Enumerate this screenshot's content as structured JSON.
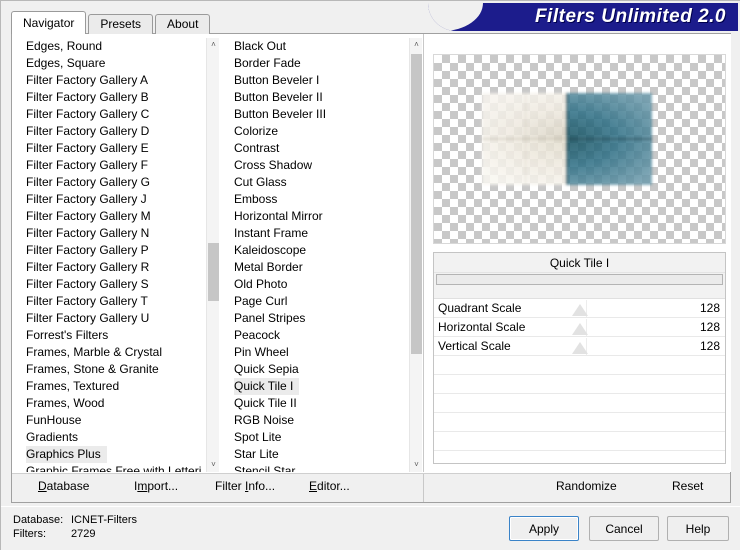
{
  "window": {
    "banner_title": "Filters Unlimited 2.0",
    "brand_color": "#1c1c8c"
  },
  "tabs": [
    {
      "label": "Navigator",
      "active": true
    },
    {
      "label": "Presets",
      "active": false
    },
    {
      "label": "About",
      "active": false
    }
  ],
  "categories": {
    "scroll_thumb_pct": 55,
    "selected": "Graphics Plus",
    "items": [
      "Edges, Round",
      "Edges, Square",
      "Filter Factory Gallery A",
      "Filter Factory Gallery B",
      "Filter Factory Gallery C",
      "Filter Factory Gallery D",
      "Filter Factory Gallery E",
      "Filter Factory Gallery F",
      "Filter Factory Gallery G",
      "Filter Factory Gallery J",
      "Filter Factory Gallery M",
      "Filter Factory Gallery N",
      "Filter Factory Gallery P",
      "Filter Factory Gallery R",
      "Filter Factory Gallery S",
      "Filter Factory Gallery T",
      "Filter Factory Gallery U",
      "Forrest's Filters",
      "Frames, Marble & Crystal",
      "Frames, Stone & Granite",
      "Frames, Textured",
      "Frames, Wood",
      "FunHouse",
      "Gradients",
      "Graphics Plus",
      "Graphic Frames Free with Lettering"
    ]
  },
  "filters": {
    "scroll_thumb_pct": 0,
    "selected": "Quick Tile I",
    "items": [
      "Black Out",
      "Border Fade",
      "Button Beveler I",
      "Button Beveler II",
      "Button Beveler III",
      "Colorize",
      "Contrast",
      "Cross Shadow",
      "Cut Glass",
      "Emboss",
      "Horizontal Mirror",
      "Instant Frame",
      "Kaleidoscope",
      "Metal Border",
      "Old Photo",
      "Page Curl",
      "Panel Stripes",
      "Peacock",
      "Pin Wheel",
      "Quick Sepia",
      "Quick Tile I",
      "Quick Tile II",
      "RGB Noise",
      "Spot Lite",
      "Star Lite",
      "Stencil Star"
    ]
  },
  "preview": {
    "alt": "quick-tile preview on transparency checkerboard",
    "tile_light_color": "#efeae0",
    "tile_teal_color": "#2e6f85"
  },
  "params": {
    "title": "Quick Tile I",
    "sliders": [
      {
        "label": "Quadrant Scale",
        "value": "128",
        "pos_pct": 50
      },
      {
        "label": "Horizontal Scale",
        "value": "128",
        "pos_pct": 50
      },
      {
        "label": "Vertical Scale",
        "value": "128",
        "pos_pct": 50
      }
    ],
    "empty_rows": 5
  },
  "toolbar": {
    "left": [
      {
        "label": "Database",
        "accel": "D"
      },
      {
        "label": "Import...",
        "accel": "m"
      },
      {
        "label": "Filter Info...",
        "accel": "I"
      },
      {
        "label": "Editor...",
        "accel": "E"
      }
    ],
    "right": [
      {
        "label": "Randomize"
      },
      {
        "label": "Reset"
      }
    ]
  },
  "status": {
    "database_key": "Database:",
    "database_value": "ICNET-Filters",
    "filters_key": "Filters:",
    "filters_value": "2729"
  },
  "actions": {
    "apply": "Apply",
    "cancel": "Cancel",
    "help": "Help"
  },
  "icons": {
    "scroll_up": "˄",
    "scroll_down": "˅"
  }
}
